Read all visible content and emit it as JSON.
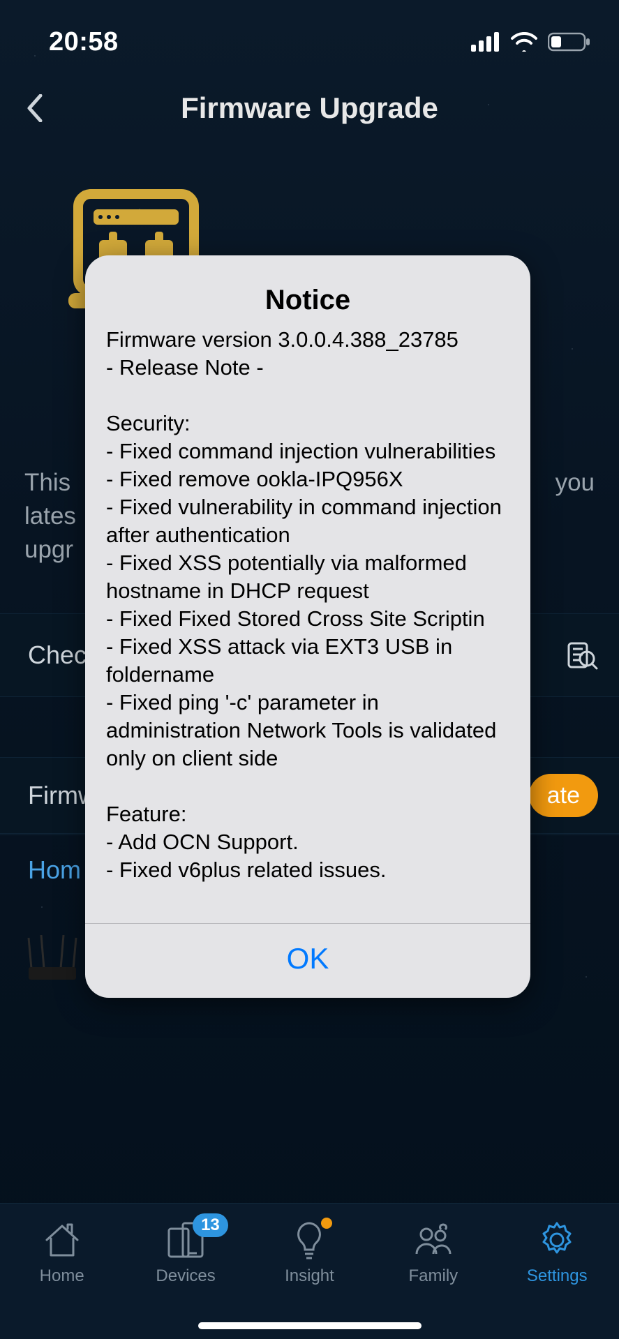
{
  "status": {
    "time": "20:58"
  },
  "nav": {
    "page_title": "Firmware Upgrade"
  },
  "background": {
    "desc_left": "This\nlates\nupgr",
    "desc_right": "you",
    "check_label": "Chec",
    "firmware_label": "Firmw",
    "update_label": "ate",
    "home_label": "Hom"
  },
  "tabs": {
    "items": [
      {
        "label": "Home"
      },
      {
        "label": "Devices",
        "badge": "13"
      },
      {
        "label": "Insight"
      },
      {
        "label": "Family"
      },
      {
        "label": "Settings"
      }
    ]
  },
  "modal": {
    "title": "Notice",
    "body": "Firmware version 3.0.0.4.388_23785\n- Release Note -\n\nSecurity:\n - Fixed command injection vulnerabilities\n - Fixed remove ookla-IPQ956X\n - Fixed vulnerability in command injection after authentication\n - Fixed XSS potentially via malformed hostname in DHCP request\n - Fixed Fixed Stored Cross Site Scriptin\n - Fixed XSS attack via EXT3 USB in foldername\n - Fixed ping '-c' parameter in administration Network Tools is validated only on client side\n\nFeature:\n - Add OCN Support.\n - Fixed v6plus related issues.",
    "ok_label": "OK"
  }
}
